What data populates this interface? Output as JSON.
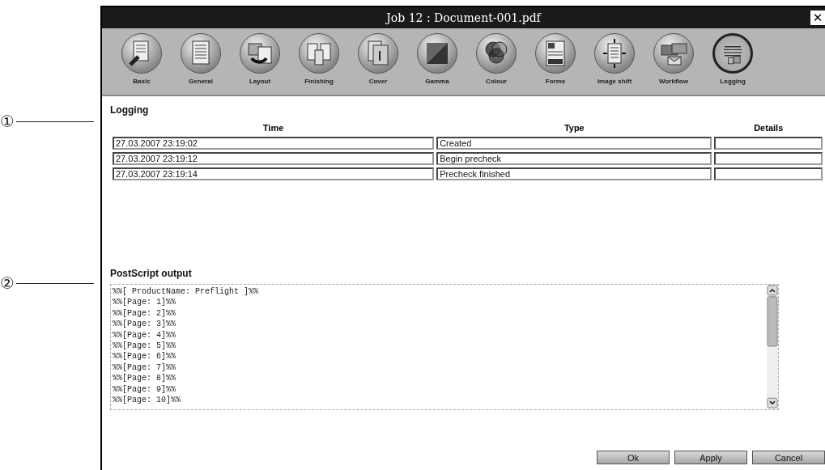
{
  "callouts": [
    "①",
    "②"
  ],
  "window": {
    "title": "Job 12 : Document-001.pdf",
    "close": "✕"
  },
  "tabs": [
    {
      "label": "Basic",
      "selected": false
    },
    {
      "label": "General",
      "selected": false
    },
    {
      "label": "Layout",
      "selected": false
    },
    {
      "label": "Finishing",
      "selected": false
    },
    {
      "label": "Cover",
      "selected": false
    },
    {
      "label": "Gamma",
      "selected": false
    },
    {
      "label": "Colour",
      "selected": false
    },
    {
      "label": "Forms",
      "selected": false
    },
    {
      "label": "Image shift",
      "selected": false
    },
    {
      "label": "Workflow",
      "selected": false
    },
    {
      "label": "Logging",
      "selected": true
    }
  ],
  "logging": {
    "heading": "Logging",
    "columns": [
      "Time",
      "Type",
      "Details"
    ],
    "rows": [
      [
        "27.03.2007 23:19:02",
        "Created",
        ""
      ],
      [
        "27.03.2007 23:19:12",
        "Begin precheck",
        ""
      ],
      [
        "27.03.2007 23:19:14",
        "Precheck finished",
        ""
      ]
    ]
  },
  "postscript": {
    "heading": "PostScript output",
    "lines": [
      "%%[ ProductName: Preflight ]%%",
      "%%[Page: 1]%%",
      "%%[Page: 2]%%",
      "%%[Page: 3]%%",
      "%%[Page: 4]%%",
      "%%[Page: 5]%%",
      "%%[Page: 6]%%",
      "%%[Page: 7]%%",
      "%%[Page: 8]%%",
      "%%[Page: 9]%%",
      "%%[Page: 10]%%"
    ]
  },
  "buttons": [
    "Ok",
    "Apply",
    "Cancel"
  ]
}
